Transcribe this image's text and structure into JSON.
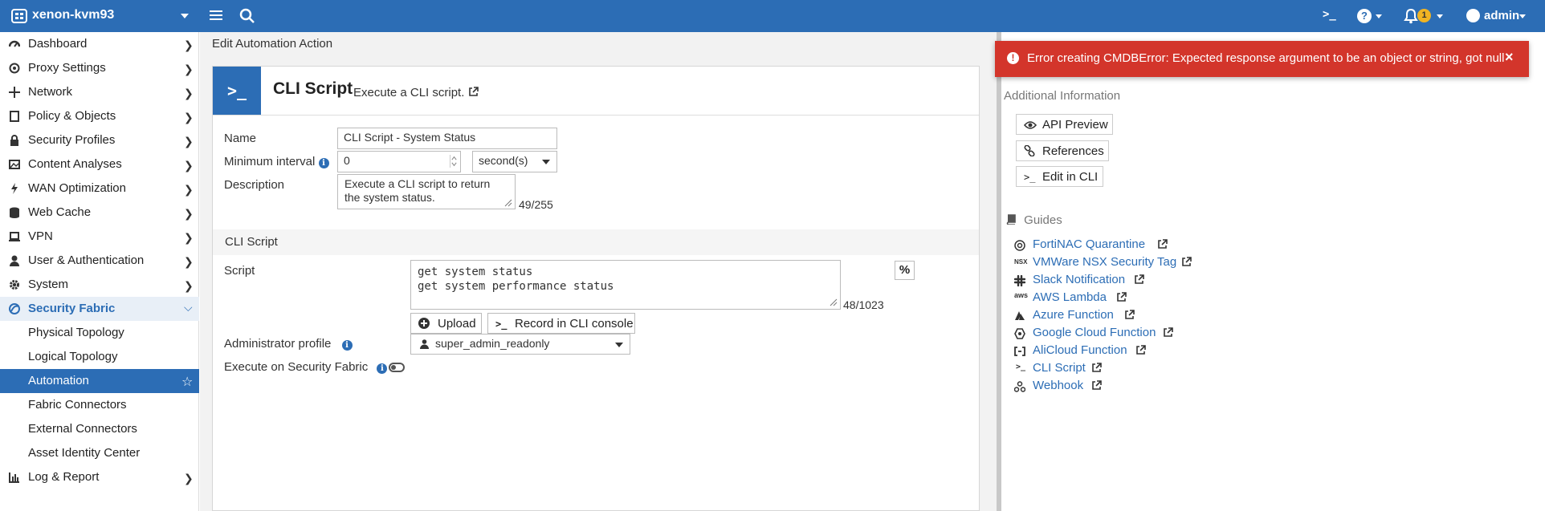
{
  "topbar": {
    "hostname": "xenon-kvm93",
    "cli_glyph": ">_",
    "help_glyph": "?",
    "notification_count": "1",
    "user": "admin"
  },
  "sidebar": {
    "items": [
      {
        "label": "Dashboard",
        "icon": "dashboard-icon"
      },
      {
        "label": "Proxy Settings",
        "icon": "proxy-icon"
      },
      {
        "label": "Network",
        "icon": "network-icon"
      },
      {
        "label": "Policy & Objects",
        "icon": "policy-icon"
      },
      {
        "label": "Security Profiles",
        "icon": "lock-icon"
      },
      {
        "label": "Content Analyses",
        "icon": "image-icon"
      },
      {
        "label": "WAN Optimization",
        "icon": "bolt-icon"
      },
      {
        "label": "Web Cache",
        "icon": "database-icon"
      },
      {
        "label": "VPN",
        "icon": "laptop-icon"
      },
      {
        "label": "User & Authentication",
        "icon": "user-icon"
      },
      {
        "label": "System",
        "icon": "gear-icon"
      },
      {
        "label": "Security Fabric",
        "icon": "fabric-icon"
      },
      {
        "label": "Physical Topology"
      },
      {
        "label": "Logical Topology"
      },
      {
        "label": "Automation"
      },
      {
        "label": "Fabric Connectors"
      },
      {
        "label": "External Connectors"
      },
      {
        "label": "Asset Identity Center"
      },
      {
        "label": "Log & Report",
        "icon": "chart-icon"
      }
    ]
  },
  "breadcrumb": "Edit Automation Action",
  "card": {
    "icon_glyph": ">_",
    "title": "CLI Script",
    "subtitle": "Execute a CLI script.",
    "form": {
      "name_label": "Name",
      "name_value": "CLI Script - System Status",
      "interval_label": "Minimum interval",
      "interval_value": "0",
      "interval_unit": "second(s)",
      "description_label": "Description",
      "description_value": "Execute a CLI script to return the system status.",
      "description_counter": "49/255",
      "section_title": "CLI Script",
      "script_label": "Script",
      "script_value": "get system status\nget system performance status",
      "script_counter": "48/1023",
      "percent_glyph": "%",
      "upload_label": "Upload",
      "record_label": "Record in CLI console",
      "admin_profile_label": "Administrator profile",
      "admin_profile_value": "super_admin_readonly",
      "exec_label": "Execute on Security Fabric"
    }
  },
  "right_panel": {
    "title": "Additional Information",
    "buttons": [
      {
        "label": "API Preview",
        "icon": "eye-icon"
      },
      {
        "label": "References",
        "icon": "link-icon"
      },
      {
        "label": "Edit in CLI",
        "icon": "terminal-icon"
      }
    ],
    "guides_title": "Guides",
    "guides": [
      {
        "label": "FortiNAC Quarantine",
        "icon": "fortinac-icon"
      },
      {
        "label": "VMWare NSX Security Tag",
        "icon": "nsx-icon",
        "glyph": "NSX"
      },
      {
        "label": "Slack Notification",
        "icon": "slack-icon"
      },
      {
        "label": "AWS Lambda",
        "icon": "aws-icon",
        "glyph": "aws"
      },
      {
        "label": "Azure Function",
        "icon": "azure-icon"
      },
      {
        "label": "Google Cloud Function",
        "icon": "gcp-icon"
      },
      {
        "label": "AliCloud Function",
        "icon": "alicloud-icon"
      },
      {
        "label": "CLI Script",
        "icon": "terminal-icon",
        "glyph": ">_"
      },
      {
        "label": "Webhook",
        "icon": "webhook-icon"
      }
    ]
  },
  "toast": {
    "message": "Error creating CMDBError: Expected response argument to be an object or string, got null",
    "close_glyph": "×",
    "icon_glyph": "!"
  },
  "colors": {
    "primary": "#2c6db5",
    "error": "#d3352b",
    "badge": "#f0b323"
  }
}
